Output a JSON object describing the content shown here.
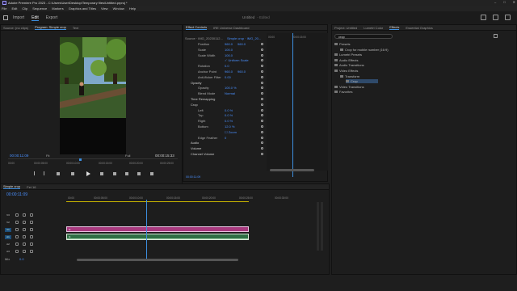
{
  "window": {
    "title": "Adobe Premiere Pro 2023 - C:\\Users\\User\\Desktop\\Temporary files\\Untitled.prproj *",
    "controls": [
      "–",
      "□",
      "✕"
    ]
  },
  "menu": [
    "File",
    "Edit",
    "Clip",
    "Sequence",
    "Markers",
    "Graphics and Titles",
    "View",
    "Window",
    "Help"
  ],
  "workspace": {
    "modes": [
      "Import",
      "Edit",
      "Export"
    ],
    "active": "Edit",
    "project": "Untitled",
    "project_status": "- Edited"
  },
  "program": {
    "tabs": [
      "Source: (no clips)",
      "Program: Simple crop",
      "Text"
    ],
    "timecode": "00:00:11:09",
    "fit": "Fit",
    "quality": "Full",
    "duration": "00:00:15:33",
    "ruler": [
      "00:00",
      "00:00:05:00",
      "00:00:10:00",
      "00:00:15:00",
      "00:00:20:00",
      "00:00:25:00"
    ]
  },
  "effect_controls": {
    "tabs": [
      "Effect Controls",
      "IRE Universe Dashboard"
    ],
    "source": "Source · IMG_20230112...",
    "sequence": "Simple crop · IMG_20...",
    "ruler": [
      "00:00",
      "00:00:15:00"
    ],
    "timecode": "00:00:11:09",
    "rows": [
      {
        "label": "Position",
        "v1": "960.0",
        "v2": "960.0"
      },
      {
        "label": "Scale",
        "v1": "100.0"
      },
      {
        "label": "Scale Width",
        "v1": "100.0"
      },
      {
        "label": "",
        "v1": "✓ Uniform Scale"
      },
      {
        "label": "Rotation",
        "v1": "0.0"
      },
      {
        "label": "Anchor Point",
        "v1": "960.0",
        "v2": "960.0"
      },
      {
        "label": "Anti-flicker Filter",
        "v1": "0.00"
      },
      {
        "label": "Opacity",
        "section": true
      },
      {
        "label": "Opacity",
        "v1": "100.0 %"
      },
      {
        "label": "Blend Mode",
        "v1": "Normal"
      },
      {
        "label": "Time Remapping",
        "section": true
      },
      {
        "label": "Crop",
        "section": true
      },
      {
        "label": "Left",
        "v1": "0.0 %"
      },
      {
        "label": "Top",
        "v1": "0.0 %"
      },
      {
        "label": "Right",
        "v1": "0.0 %"
      },
      {
        "label": "Bottom",
        "v1": "12.0 %"
      },
      {
        "label": "",
        "v1": "☐ Zoom"
      },
      {
        "label": "Edge Feather",
        "v1": "0"
      },
      {
        "label": "Audio",
        "section": true
      },
      {
        "label": "Volume",
        "section": true
      },
      {
        "label": "Channel Volume",
        "section": true
      }
    ]
  },
  "effects_panel": {
    "tabs": [
      "Project: Untitled",
      "Lumetri Color",
      "Effects",
      "Essential Graphics"
    ],
    "search": "crop",
    "tree": [
      {
        "label": "Presets",
        "depth": 0
      },
      {
        "label": "Crop for mobile number (16:9)",
        "depth": 1
      },
      {
        "label": "Lumetri Presets",
        "depth": 0
      },
      {
        "label": "Audio Effects",
        "depth": 0
      },
      {
        "label": "Audio Transitions",
        "depth": 0
      },
      {
        "label": "Video Effects",
        "depth": 0
      },
      {
        "label": "Transform",
        "depth": 1
      },
      {
        "label": "Crop",
        "depth": 2
      },
      {
        "label": "Video Transitions",
        "depth": 0
      },
      {
        "label": "Favorites",
        "depth": 0
      }
    ]
  },
  "timeline": {
    "tabs": [
      "Simple crop",
      "Fet 16"
    ],
    "timecode": "00:00:11:09",
    "ruler": [
      "00:00",
      "00:00:05:00",
      "00:00:10:00",
      "00:00:15:00",
      "00:00:20:00",
      "00:00:25:00",
      "00:00:30:00"
    ],
    "tracks": [
      {
        "name": "V3",
        "type": "v"
      },
      {
        "name": "V2",
        "type": "v"
      },
      {
        "name": "V1",
        "type": "v",
        "on": true
      },
      {
        "name": "A1",
        "type": "a",
        "on": true
      },
      {
        "name": "A2",
        "type": "a"
      },
      {
        "name": "A3",
        "type": "a"
      }
    ],
    "clip_video": "fx",
    "clip_audio": "fx",
    "mix": "Mix",
    "mix_val": "0.0"
  }
}
